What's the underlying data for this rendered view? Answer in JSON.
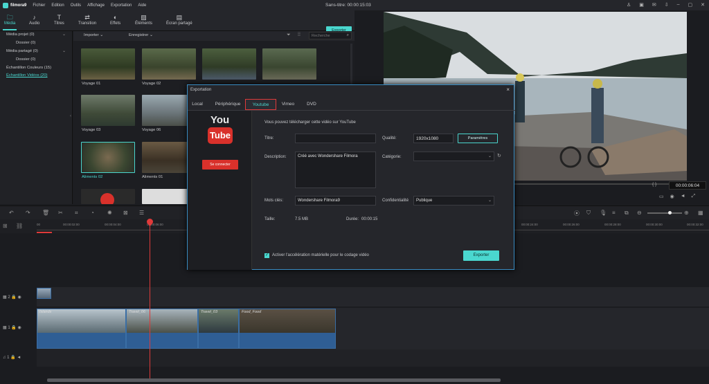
{
  "app": {
    "name": "filmora9",
    "title": "Sans-titre:",
    "time": "00:00:15:03"
  },
  "menu": [
    "Fichier",
    "Edition",
    "Outils",
    "Affichage",
    "Exportation",
    "Aide"
  ],
  "toolbar": {
    "tabs": [
      "Média",
      "Audio",
      "Titres",
      "Transition",
      "Effets",
      "Éléments",
      "Écran partagé"
    ],
    "export_label": "Exporter"
  },
  "sidebar": {
    "items": [
      "Média projet (0)",
      "Dossier (0)",
      "Média partagé (0)",
      "Dossier (0)",
      "Échantillon Couleurs (15)",
      "Échantillon Vidéos (20)"
    ]
  },
  "media": {
    "import_label": "Importer",
    "record_label": "Enregistrer",
    "search_placeholder": "Recherche",
    "thumbs": [
      "Voyage 01",
      "Voyage 02",
      "Voyage 03",
      "Voyage 06",
      "Aliments 02",
      "Aliments 01"
    ]
  },
  "preview": {
    "timecode": "00:00:06:04",
    "brackets": "{  }"
  },
  "ruler": [
    "00:00:02:00",
    "00:00:04:00",
    "00:00:06:00",
    "00:00:24:00",
    "00:00:26:00",
    "00:00:28:00",
    "00:00:30:00",
    "00:00:32:00"
  ],
  "ruler_start": "00",
  "tracks": {
    "labels": [
      "2",
      "1",
      "1"
    ]
  },
  "clips": [
    "Islands",
    "Travel_06",
    "Travel_03",
    "Food_Food"
  ],
  "dialog": {
    "title": "Exportation",
    "close": "×",
    "tabs": [
      "Local",
      "Périphérique",
      "Youtube",
      "Vimeo",
      "DVD"
    ],
    "youtube_logo_top": "You",
    "youtube_logo_bottom": "Tube",
    "connect": "Se connecter",
    "intro": "Vous pouvez télécharger cette vidéo sur YouTube",
    "title_label": "Titre:",
    "title_value": "",
    "quality_label": "Qualité:",
    "quality_value": "1920x1080",
    "params_label": "Paramètres",
    "description_label": "Description:",
    "description_value": "Créé avec Wondershare Filmora",
    "category_label": "Catégorie:",
    "category_value": "",
    "keywords_label": "Mots clés:",
    "keywords_value": "Wondershare Filmora9",
    "privacy_label": "Confidentialité",
    "privacy_value": "Publique",
    "size_label": "Taille:",
    "size_value": "7.5 MB",
    "duration_label": "Durée:",
    "duration_value": "00:00:15",
    "hw_accel": "Activer l'accélération matérielle pour le codage vidéo",
    "export_label": "Exporter"
  },
  "colors": {
    "accent": "#4ad7cf",
    "youtube_red": "#d9312b",
    "playhead": "#e03a3a"
  }
}
